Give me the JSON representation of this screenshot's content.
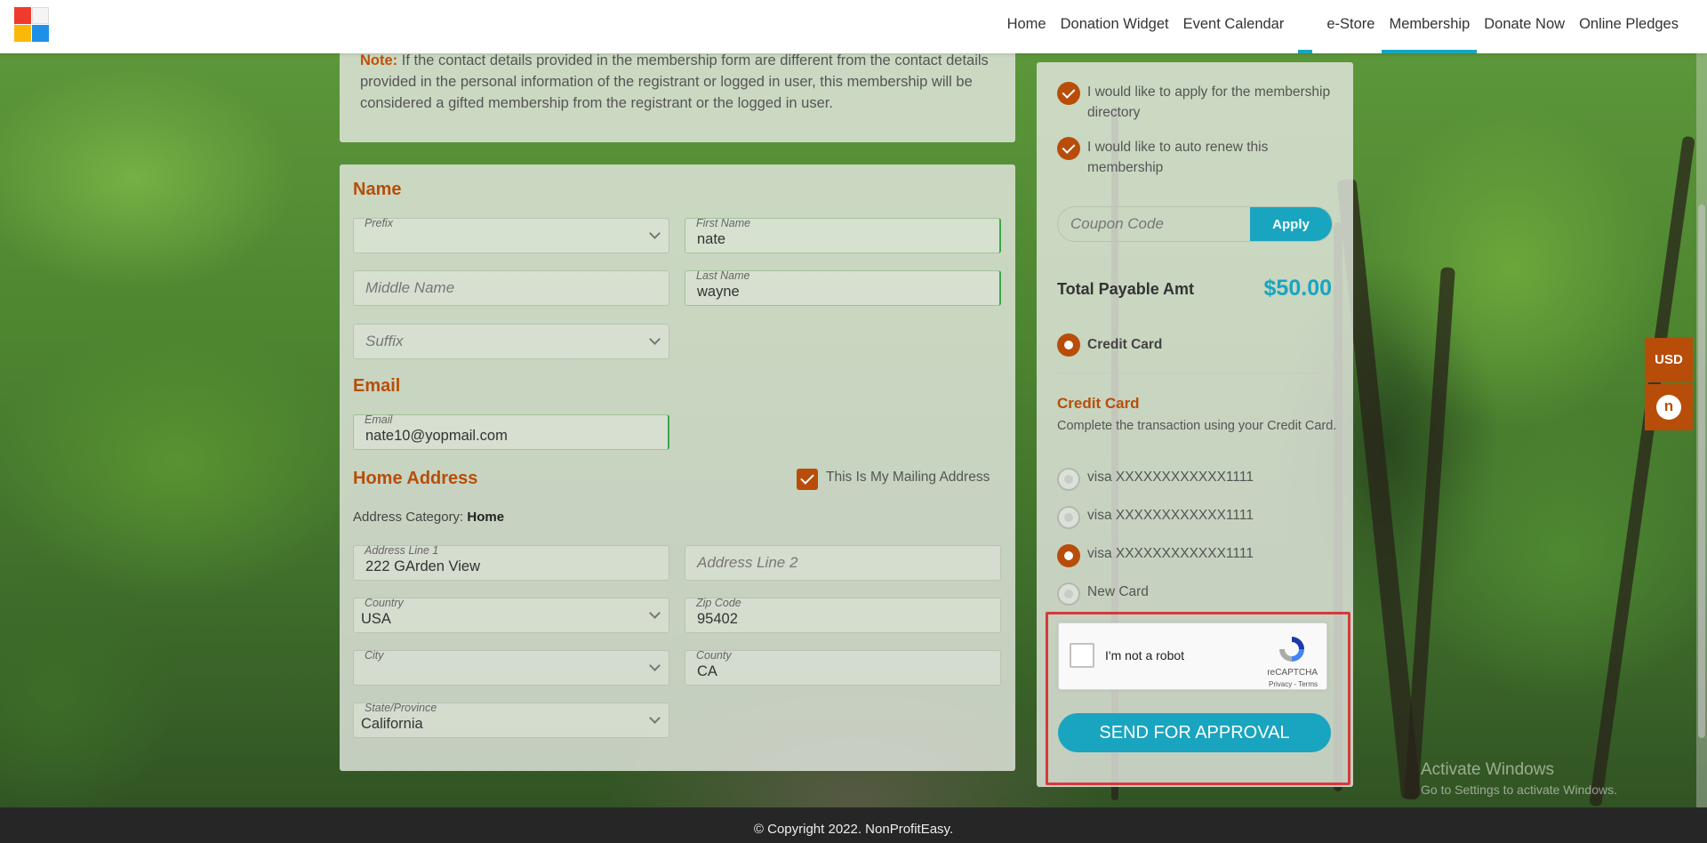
{
  "nav": {
    "items": [
      "Home",
      "Donation Widget",
      "Event Calendar",
      "e-Store",
      "Membership",
      "Donate Now",
      "Online Pledges"
    ],
    "active": "Membership"
  },
  "note": {
    "label": "Note:",
    "text": "If the contact details provided in the membership form are different from the contact details provided in the personal information of the registrant or logged in user, this membership will be considered a gifted membership from the registrant or the logged in user."
  },
  "name_section": {
    "title": "Name",
    "prefix": {
      "label": "Prefix",
      "value": ""
    },
    "first_name": {
      "label": "First Name",
      "value": "nate"
    },
    "middle_name": {
      "placeholder": "Middle Name"
    },
    "last_name": {
      "label": "Last Name",
      "value": "wayne"
    },
    "suffix": {
      "placeholder": "Suffix"
    }
  },
  "email_section": {
    "title": "Email",
    "email": {
      "label": "Email",
      "value": "nate10@yopmail.com"
    }
  },
  "address_section": {
    "title": "Home Address",
    "mailing_label": "This Is My Mailing Address",
    "category_label": "Address Category:",
    "category_value": "Home",
    "line1": {
      "label": "Address Line 1",
      "value": "222 GArden View"
    },
    "line2": {
      "placeholder": "Address Line 2"
    },
    "country": {
      "label": "Country",
      "value": "USA"
    },
    "zip": {
      "label": "Zip Code",
      "value": "95402"
    },
    "city": {
      "label": "City",
      "value": ""
    },
    "county": {
      "label": "County",
      "value": "CA"
    },
    "state": {
      "label": "State/Province",
      "value": "California"
    }
  },
  "payment": {
    "opt_directory": "I would like to apply for the membership directory",
    "opt_renew": "I would like to auto renew this membership",
    "coupon_placeholder": "Coupon Code",
    "apply_label": "Apply",
    "total_label": "Total Payable Amt",
    "total_value": "$50.00",
    "method_label": "Credit Card",
    "cc_title": "Credit Card",
    "cc_desc": "Complete the transaction using your Credit Card.",
    "cards": [
      "visa XXXXXXXXXXXX1111",
      "visa XXXXXXXXXXXX1111",
      "visa XXXXXXXXXXXX1111"
    ],
    "new_card": "New Card",
    "selected_card_index": 2,
    "captcha_label": "I'm not a robot",
    "captcha_brand": "reCAPTCHA",
    "captcha_links": "Privacy - Terms",
    "send_label": "SEND FOR APPROVAL"
  },
  "side": {
    "currency": "USD",
    "n_label": "n"
  },
  "watermark": {
    "line1": "Activate Windows",
    "line2": "Go to Settings to activate Windows."
  },
  "footer": {
    "copyright": "© Copyright 2022. NonProfitEasy."
  },
  "colors": {
    "accent": "#b84d0a",
    "primary": "#19a5bf",
    "highlight": "#d43a3a"
  }
}
